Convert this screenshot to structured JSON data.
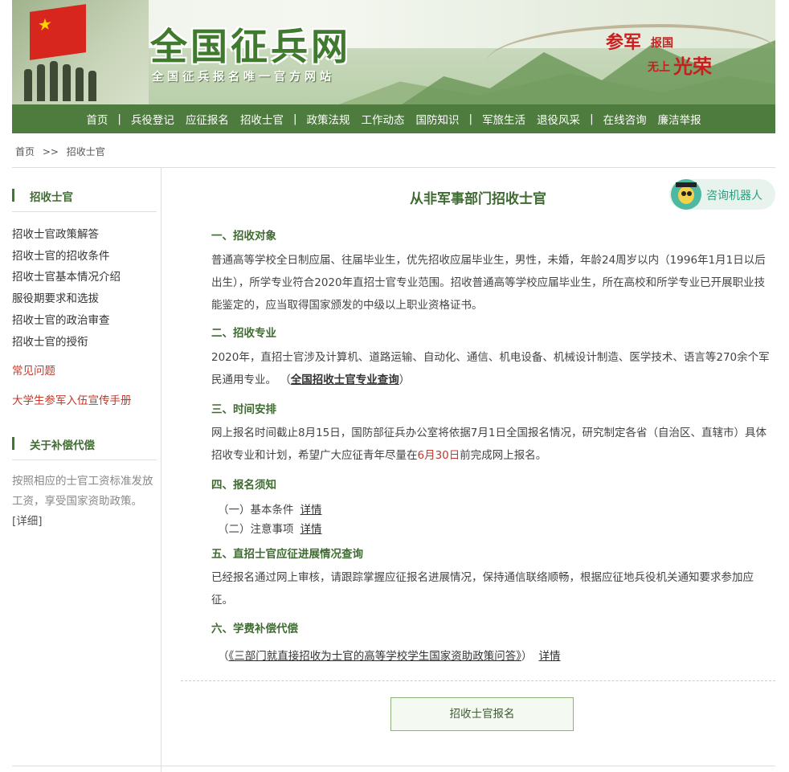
{
  "banner": {
    "site_title": "全国征兵网",
    "site_subtitle": "全国征兵报名唯一官方网站",
    "slogan_1": "参军",
    "slogan_2": "报国",
    "slogan_3": "无上",
    "slogan_4": "光荣"
  },
  "nav": {
    "items": [
      "首页",
      "兵役登记",
      "应征报名",
      "招收士官",
      "政策法规",
      "工作动态",
      "国防知识",
      "军旅生活",
      "退役风采",
      "在线咨询",
      "廉洁举报"
    ],
    "separator": "|"
  },
  "breadcrumb": {
    "home": "首页",
    "sep": ">>",
    "current": "招收士官"
  },
  "sidebar": {
    "section1_title": "招收士官",
    "links": [
      "招收士官政策解答",
      "招收士官的招收条件",
      "招收士官基本情况介绍",
      "服役期要求和选拔",
      "招收士官的政治审查",
      "招收士官的授衔"
    ],
    "faq": "常见问题",
    "handbook": "大学生参军入伍宣传手册",
    "section2_title": "关于补偿代偿",
    "desc": "按照相应的士官工资标准发放工资，享受国家资助政策。",
    "detail": "[详细]"
  },
  "main": {
    "title": "从非军事部门招收士官",
    "robot_label": "咨询机器人",
    "s1_title": "一、招收对象",
    "s1_text": "普通高等学校全日制应届、往届毕业生，优先招收应届毕业生，男性，未婚，年龄24周岁以内（1996年1月1日以后出生），所学专业符合2020年直招士官专业范围。招收普通高等学校应届毕业生，所在高校和所学专业已开展职业技能鉴定的，应当取得国家颁发的中级以上职业资格证书。",
    "s2_title": "二、招收专业",
    "s2_text": "2020年，直招士官涉及计算机、道路运输、自动化、通信、机电设备、机械设计制造、医学技术、语言等270余个军民通用专业。",
    "s2_open": "（",
    "s2_link": "全国招收士官专业查询",
    "s2_close": "）",
    "s3_title": "三、时间安排",
    "s3_text_a": "网上报名时间截止8月15日，国防部征兵办公室将依据7月1日全国报名情况，研究制定各省（自治区、直辖市）具体招收专业和计划，希望广大应征青年尽量在",
    "s3_text_red": "6月30日",
    "s3_text_b": "前完成网上报名。",
    "s4_title": "四、报名须知",
    "s4_item1": "（一）基本条件",
    "s4_item2": "（二）注意事项",
    "detail": "详情",
    "s5_title": "五、直招士官应征进展情况查询",
    "s5_text": "已经报名通过网上审核，请跟踪掌握应征报名进展情况，保持通信联络顺畅，根据应征地兵役机关通知要求参加应征。",
    "s6_title": "六、学费补偿代偿",
    "s6_open": "（",
    "s6_link": "《三部门就直接招收为士官的高等学校学生国家资助政策问答》",
    "s6_close": "）",
    "apply_button": "招收士官报名"
  }
}
